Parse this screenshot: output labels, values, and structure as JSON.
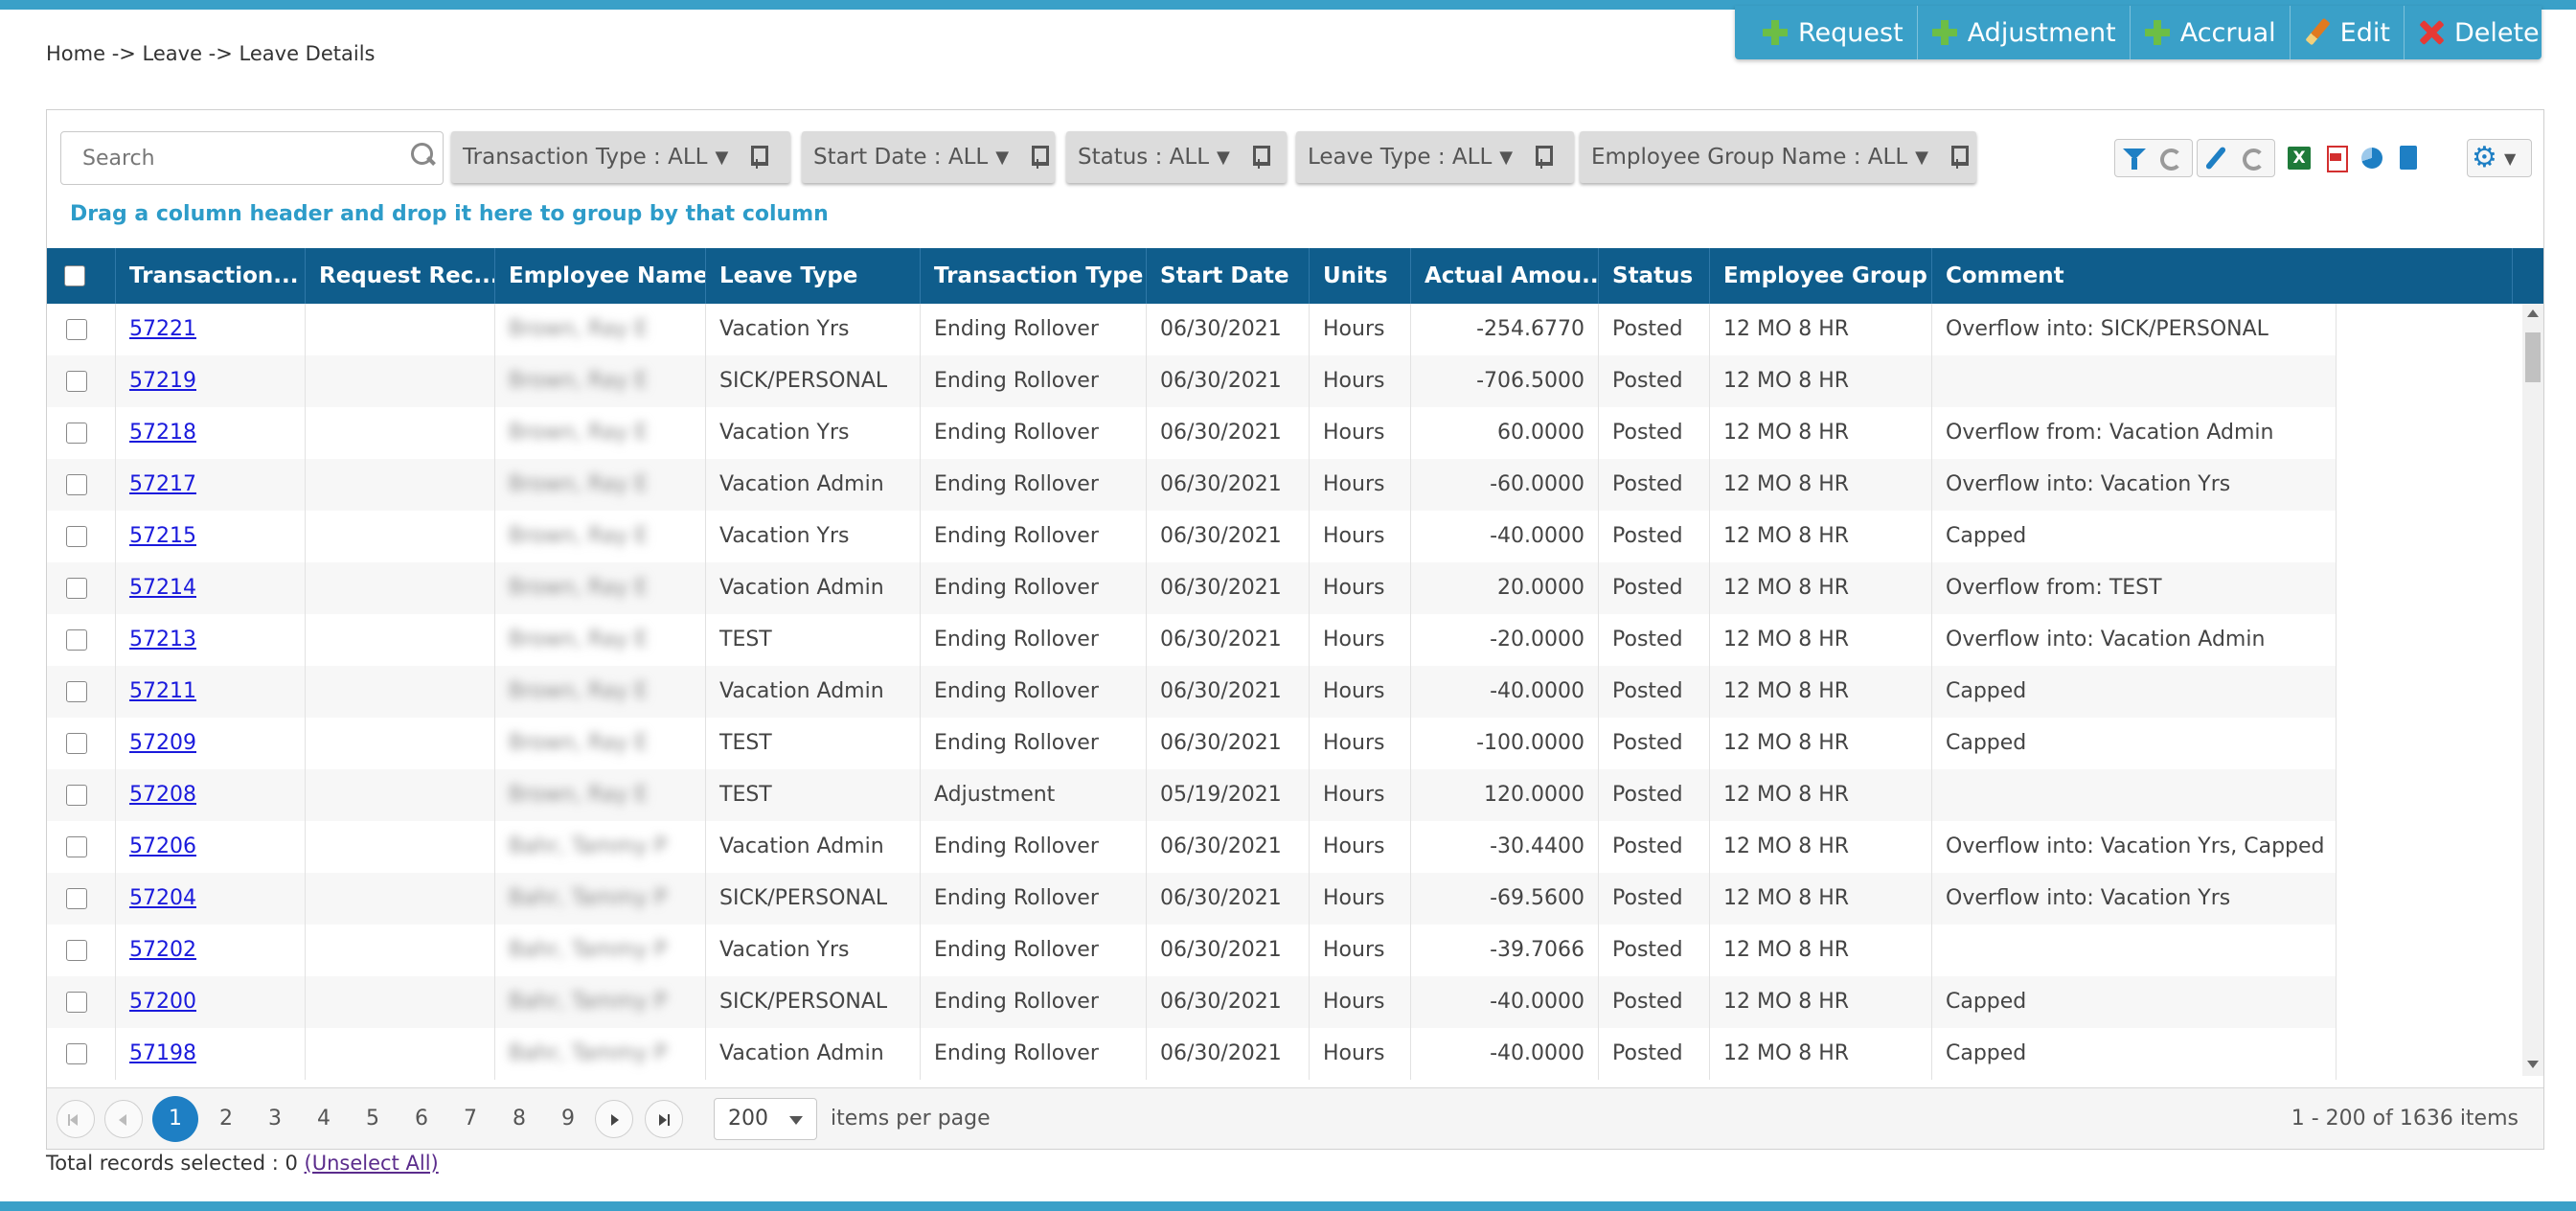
{
  "breadcrumb": "Home -> Leave -> Leave Details",
  "actions": [
    {
      "label": "Request",
      "icon": "plus-icon"
    },
    {
      "label": "Adjustment",
      "icon": "plus-icon"
    },
    {
      "label": "Accrual",
      "icon": "plus-icon"
    },
    {
      "label": "Edit",
      "icon": "pencil-icon"
    },
    {
      "label": "Delete",
      "icon": "delete-x-icon"
    }
  ],
  "search": {
    "placeholder": "Search",
    "value": ""
  },
  "filters": [
    {
      "label": "Transaction Type : ALL"
    },
    {
      "label": "Start Date : ALL"
    },
    {
      "label": "Status : ALL"
    },
    {
      "label": "Leave Type : ALL"
    },
    {
      "label": "Employee Group Name : ALL"
    }
  ],
  "toolbar_icons": [
    "funnel-icon",
    "refresh-icon",
    "wrench-icon",
    "refresh-icon",
    "excel-icon",
    "pdf-icon",
    "chart-icon",
    "document-icon",
    "gear-icon"
  ],
  "group_hint": "Drag a column header and drop it here to group by that column",
  "columns": [
    "Transaction...",
    "Request Rec...",
    "Employee Name",
    "Leave Type",
    "Transaction Type",
    "Start Date",
    "Units",
    "Actual Amou...",
    "Status",
    "Employee Group",
    "Comment"
  ],
  "sort_indicator": "↓",
  "rows": [
    {
      "id": "57221",
      "request": "",
      "employee": "Brown, Ray E",
      "leave_type": "Vacation Yrs",
      "txn_type": "Ending Rollover",
      "start_date": "06/30/2021",
      "units": "Hours",
      "amount": "-254.6770",
      "status": "Posted",
      "group": "12 MO 8 HR",
      "comment": "Overflow into: SICK/PERSONAL"
    },
    {
      "id": "57219",
      "request": "",
      "employee": "Brown, Ray E",
      "leave_type": "SICK/PERSONAL",
      "txn_type": "Ending Rollover",
      "start_date": "06/30/2021",
      "units": "Hours",
      "amount": "-706.5000",
      "status": "Posted",
      "group": "12 MO 8 HR",
      "comment": ""
    },
    {
      "id": "57218",
      "request": "",
      "employee": "Brown, Ray E",
      "leave_type": "Vacation Yrs",
      "txn_type": "Ending Rollover",
      "start_date": "06/30/2021",
      "units": "Hours",
      "amount": "60.0000",
      "status": "Posted",
      "group": "12 MO 8 HR",
      "comment": "Overflow from: Vacation Admin"
    },
    {
      "id": "57217",
      "request": "",
      "employee": "Brown, Ray E",
      "leave_type": "Vacation Admin",
      "txn_type": "Ending Rollover",
      "start_date": "06/30/2021",
      "units": "Hours",
      "amount": "-60.0000",
      "status": "Posted",
      "group": "12 MO 8 HR",
      "comment": "Overflow into: Vacation Yrs"
    },
    {
      "id": "57215",
      "request": "",
      "employee": "Brown, Ray E",
      "leave_type": "Vacation Yrs",
      "txn_type": "Ending Rollover",
      "start_date": "06/30/2021",
      "units": "Hours",
      "amount": "-40.0000",
      "status": "Posted",
      "group": "12 MO 8 HR",
      "comment": "Capped"
    },
    {
      "id": "57214",
      "request": "",
      "employee": "Brown, Ray E",
      "leave_type": "Vacation Admin",
      "txn_type": "Ending Rollover",
      "start_date": "06/30/2021",
      "units": "Hours",
      "amount": "20.0000",
      "status": "Posted",
      "group": "12 MO 8 HR",
      "comment": "Overflow from: TEST"
    },
    {
      "id": "57213",
      "request": "",
      "employee": "Brown, Ray E",
      "leave_type": "TEST",
      "txn_type": "Ending Rollover",
      "start_date": "06/30/2021",
      "units": "Hours",
      "amount": "-20.0000",
      "status": "Posted",
      "group": "12 MO 8 HR",
      "comment": "Overflow into: Vacation Admin"
    },
    {
      "id": "57211",
      "request": "",
      "employee": "Brown, Ray E",
      "leave_type": "Vacation Admin",
      "txn_type": "Ending Rollover",
      "start_date": "06/30/2021",
      "units": "Hours",
      "amount": "-40.0000",
      "status": "Posted",
      "group": "12 MO 8 HR",
      "comment": "Capped"
    },
    {
      "id": "57209",
      "request": "",
      "employee": "Brown, Ray E",
      "leave_type": "TEST",
      "txn_type": "Ending Rollover",
      "start_date": "06/30/2021",
      "units": "Hours",
      "amount": "-100.0000",
      "status": "Posted",
      "group": "12 MO 8 HR",
      "comment": "Capped"
    },
    {
      "id": "57208",
      "request": "",
      "employee": "Brown, Ray E",
      "leave_type": "TEST",
      "txn_type": "Adjustment",
      "start_date": "05/19/2021",
      "units": "Hours",
      "amount": "120.0000",
      "status": "Posted",
      "group": "12 MO 8 HR",
      "comment": ""
    },
    {
      "id": "57206",
      "request": "",
      "employee": "Bahr, Tammy P",
      "leave_type": "Vacation Admin",
      "txn_type": "Ending Rollover",
      "start_date": "06/30/2021",
      "units": "Hours",
      "amount": "-30.4400",
      "status": "Posted",
      "group": "12 MO 8 HR",
      "comment": "Overflow into: Vacation Yrs, Capped"
    },
    {
      "id": "57204",
      "request": "",
      "employee": "Bahr, Tammy P",
      "leave_type": "SICK/PERSONAL",
      "txn_type": "Ending Rollover",
      "start_date": "06/30/2021",
      "units": "Hours",
      "amount": "-69.5600",
      "status": "Posted",
      "group": "12 MO 8 HR",
      "comment": "Overflow into: Vacation Yrs"
    },
    {
      "id": "57202",
      "request": "",
      "employee": "Bahr, Tammy P",
      "leave_type": "Vacation Yrs",
      "txn_type": "Ending Rollover",
      "start_date": "06/30/2021",
      "units": "Hours",
      "amount": "-39.7066",
      "status": "Posted",
      "group": "12 MO 8 HR",
      "comment": ""
    },
    {
      "id": "57200",
      "request": "",
      "employee": "Bahr, Tammy P",
      "leave_type": "SICK/PERSONAL",
      "txn_type": "Ending Rollover",
      "start_date": "06/30/2021",
      "units": "Hours",
      "amount": "-40.0000",
      "status": "Posted",
      "group": "12 MO 8 HR",
      "comment": "Capped"
    },
    {
      "id": "57198",
      "request": "",
      "employee": "Bahr, Tammy P",
      "leave_type": "Vacation Admin",
      "txn_type": "Ending Rollover",
      "start_date": "06/30/2021",
      "units": "Hours",
      "amount": "-40.0000",
      "status": "Posted",
      "group": "12 MO 8 HR",
      "comment": "Capped"
    }
  ],
  "pager": {
    "pages": [
      "1",
      "2",
      "3",
      "4",
      "5",
      "6",
      "7",
      "8",
      "9"
    ],
    "current": "1",
    "page_size": "200",
    "items_per_page_label": "items per page",
    "info": "1 - 200 of 1636 items"
  },
  "footer": {
    "total_selected_label": "Total records selected : 0",
    "unselect_all": "(Unselect All)"
  },
  "colors": {
    "accent": "#3aa0c8",
    "header": "#0f5d8c",
    "link": "#1a1adc",
    "active_page": "#1e7fc4"
  }
}
